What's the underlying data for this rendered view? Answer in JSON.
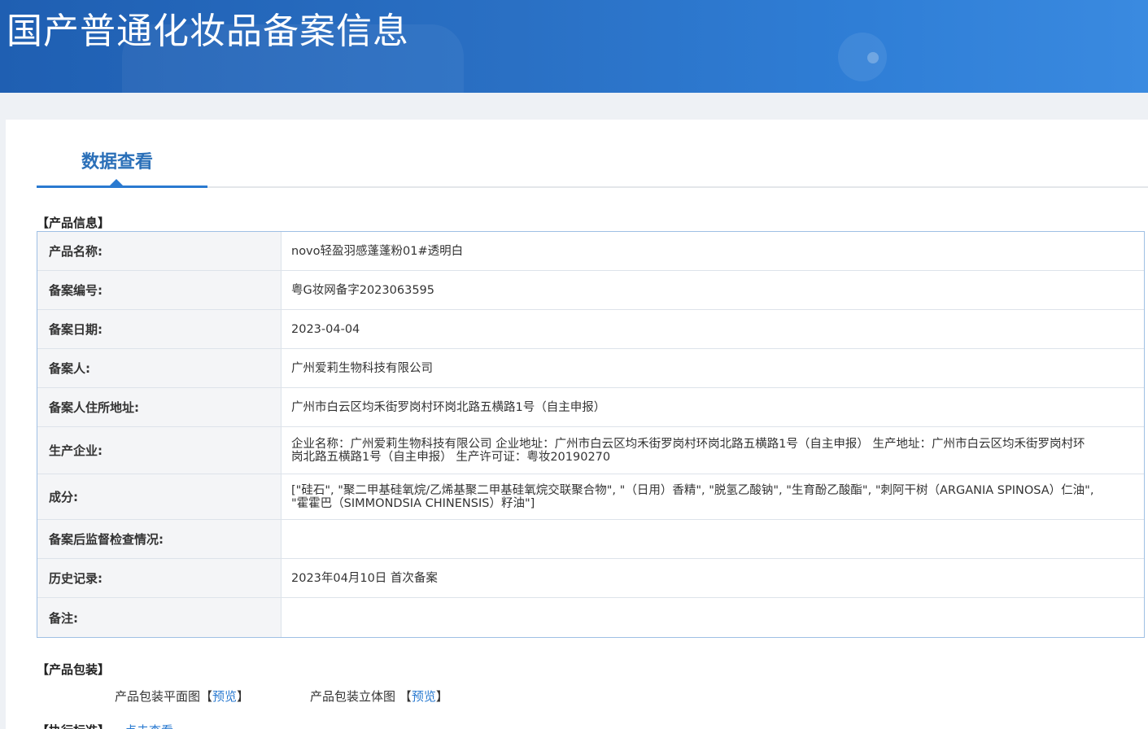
{
  "banner": {
    "title": "国产普通化妆品备案信息"
  },
  "tab": {
    "label": "数据查看"
  },
  "product_info": {
    "section_title": "【产品信息】",
    "rows": [
      {
        "label": "产品名称:",
        "value": "novo轻盈羽感蓬蓬粉01#透明白"
      },
      {
        "label": "备案编号:",
        "value": "粤G妆网备字2023063595"
      },
      {
        "label": "备案日期:",
        "value": "2023-04-04"
      },
      {
        "label": "备案人:",
        "value": "广州爱莉生物科技有限公司"
      },
      {
        "label": "备案人住所地址:",
        "value": "广州市白云区均禾街罗岗村环岗北路五横路1号（自主申报）"
      },
      {
        "label": "生产企业:",
        "value": "企业名称：广州爱莉生物科技有限公司 企业地址：广州市白云区均禾街罗岗村环岗北路五横路1号（自主申报） 生产地址：广州市白云区均禾街罗岗村环岗北路五横路1号（自主申报） 生产许可证：粤妆20190270"
      },
      {
        "label": "成分:",
        "value": "[\"硅石\", \"聚二甲基硅氧烷/乙烯基聚二甲基硅氧烷交联聚合物\", \"（日用）香精\", \"脱氢乙酸钠\", \"生育酚乙酸酯\", \"刺阿干树（ARGANIA SPINOSA）仁油\", \"霍霍巴（SIMMONDSIA CHINENSIS）籽油\"]"
      },
      {
        "label": "备案后监督检查情况:",
        "value": ""
      },
      {
        "label": "历史记录:",
        "value": "2023年04月10日 首次备案"
      },
      {
        "label": "备注:",
        "value": ""
      }
    ]
  },
  "packaging": {
    "section_title": "【产品包装】",
    "flat_label": "产品包装平面图",
    "flat_link": "预览",
    "solid_label": "产品包装立体图",
    "solid_link": "预览",
    "bracket_open": "【",
    "bracket_close": "】"
  },
  "standard": {
    "section_title": "【执行标准】",
    "link": "点击查看"
  }
}
